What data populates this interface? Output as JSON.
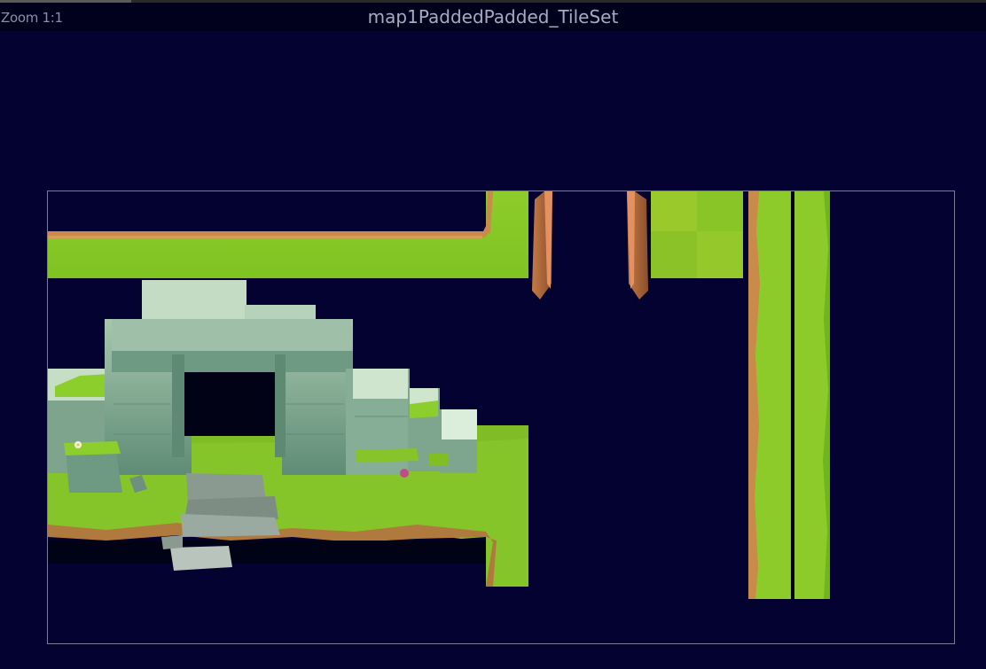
{
  "header": {
    "zoom_label": "Zoom 1:1",
    "title": "map1PaddedPadded_TileSet"
  },
  "colors": {
    "background": "#030231",
    "titlebar": "#01011e",
    "grass": "#8ac926",
    "grass_dark": "#6fb51c",
    "dirt": "#c98a4a",
    "stone": "#6e9a83",
    "stone_light": "#cfe3cd",
    "wood": "#b06a3a"
  },
  "icons": [
    "tile-grass-strip",
    "tile-ruins-arch",
    "tile-wooden-post",
    "tile-grass-block",
    "tile-grass-column"
  ]
}
